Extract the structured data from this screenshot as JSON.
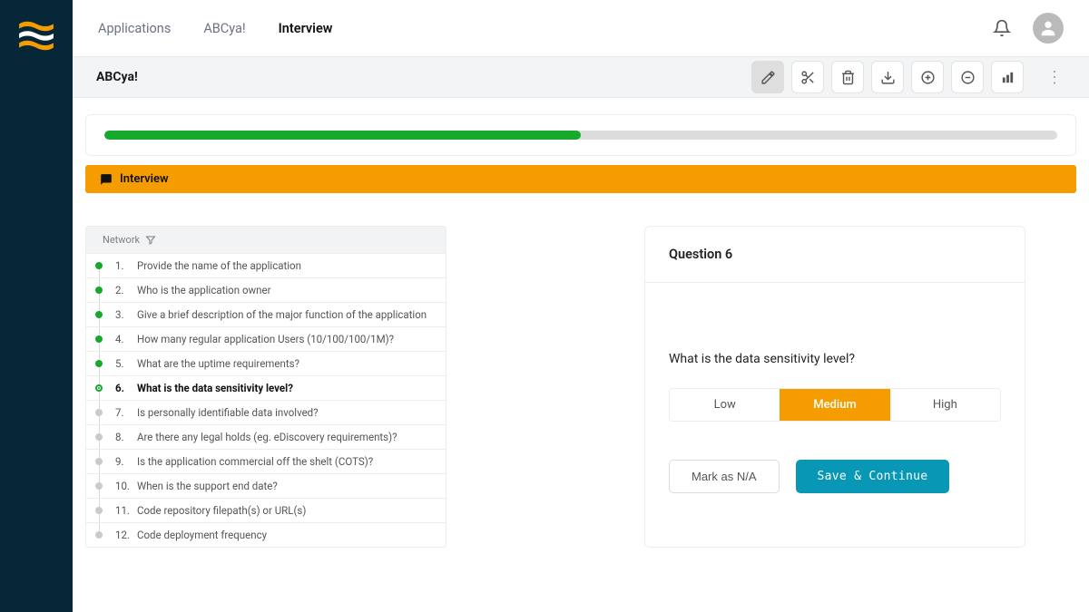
{
  "breadcrumbs": {
    "items": [
      "Applications",
      "ABCya!",
      "Interview"
    ],
    "active_index": 2
  },
  "page_title": "ABCya!",
  "section_label": "Interview",
  "progress": {
    "percent": 50
  },
  "qlist": {
    "group_label": "Network",
    "current_index": 5,
    "items": [
      {
        "num": "1.",
        "text": "Provide the name of the application",
        "status": "done"
      },
      {
        "num": "2.",
        "text": "Who is the application owner",
        "status": "done"
      },
      {
        "num": "3.",
        "text": "Give a brief description of the major function of the application",
        "status": "done"
      },
      {
        "num": "4.",
        "text": "How many regular application Users (10/100/100/1M)?",
        "status": "done"
      },
      {
        "num": "5.",
        "text": "What are the uptime requirements?",
        "status": "done"
      },
      {
        "num": "6.",
        "text": "What is the data sensitivity level?",
        "status": "current"
      },
      {
        "num": "7.",
        "text": "Is personally identifiable data involved?",
        "status": "todo"
      },
      {
        "num": "8.",
        "text": "Are there any legal holds (eg. eDiscovery requirements)?",
        "status": "todo"
      },
      {
        "num": "9.",
        "text": "Is the application commercial off the shelt (COTS)?",
        "status": "todo"
      },
      {
        "num": "10.",
        "text": "When is the support end date?",
        "status": "todo"
      },
      {
        "num": "11.",
        "text": "Code repository filepath(s) or URL(s)",
        "status": "todo"
      },
      {
        "num": "12.",
        "text": "Code deployment frequency",
        "status": "todo"
      }
    ]
  },
  "question_card": {
    "heading": "Question 6",
    "text": "What is the data sensitivity level?",
    "options": [
      "Low",
      "Medium",
      "High"
    ],
    "selected": "Medium",
    "mark_na_label": "Mark as N/A",
    "save_label": "Save & Continue"
  }
}
